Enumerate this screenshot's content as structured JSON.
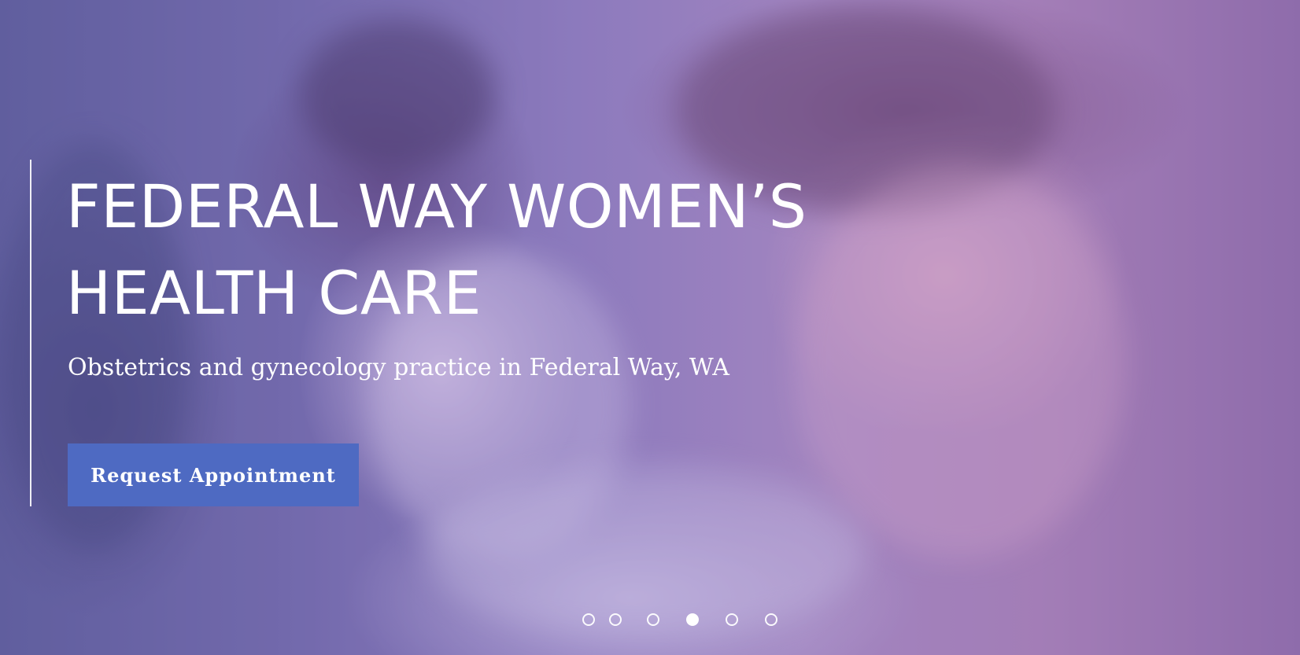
{
  "hero": {
    "title_line_1": "FEDERAL WAY WOMEN’S",
    "title_line_2": "HEALTH CARE",
    "subtitle": "Obstetrics and gynecology practice in Federal Way, WA",
    "cta_label": "Request Appointment"
  },
  "slider": {
    "slide_count": 6,
    "active_index": 4
  },
  "colors": {
    "accent": "#4e6ac2",
    "text": "#ffffff",
    "overlay": "#6a5eb8"
  }
}
